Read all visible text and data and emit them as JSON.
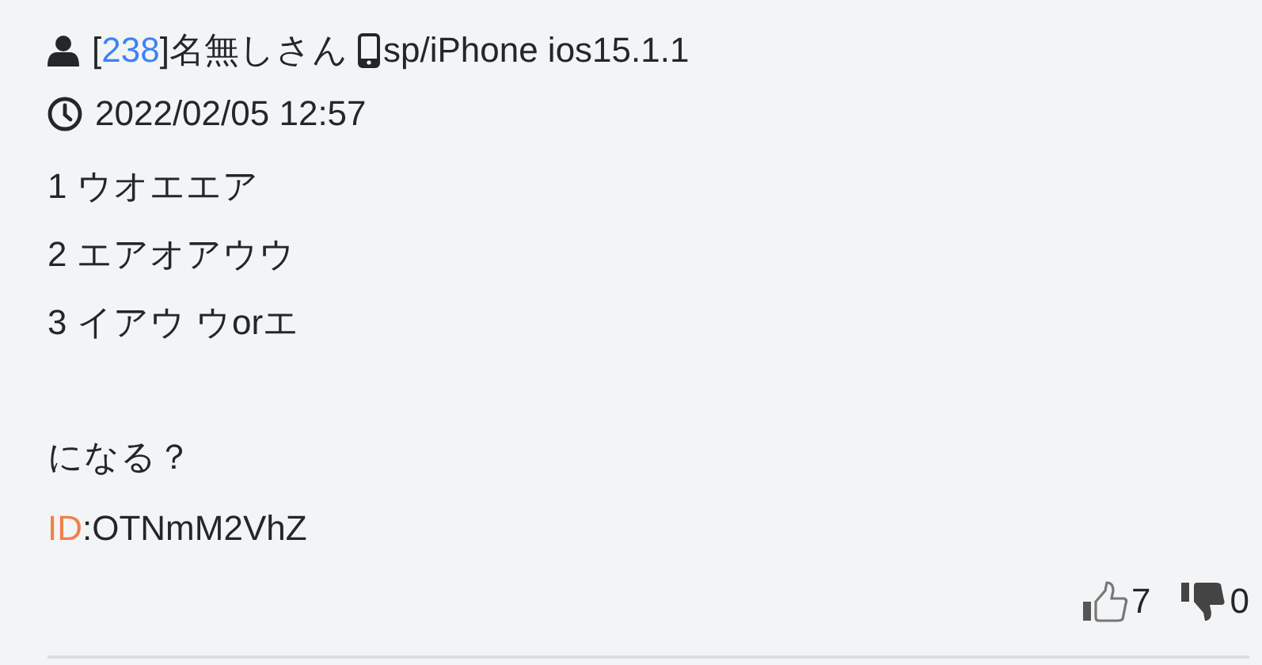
{
  "post": {
    "bracket_open": "[",
    "number": "238",
    "bracket_close": "]",
    "name": "名無しさん",
    "device": "sp/iPhone ios15.1.1",
    "date": "2022/02/05 12:57",
    "paragraphs": [
      [
        "1 ウオエエア",
        "2 エアオアウウ",
        "3 イアウ ウorエ"
      ],
      [
        "になる？"
      ]
    ],
    "id_label": "ID",
    "id_value": ":OTNmM2VhZ",
    "votes": [
      {
        "kind": "up",
        "count": "7"
      },
      {
        "kind": "down",
        "count": "0"
      }
    ]
  }
}
